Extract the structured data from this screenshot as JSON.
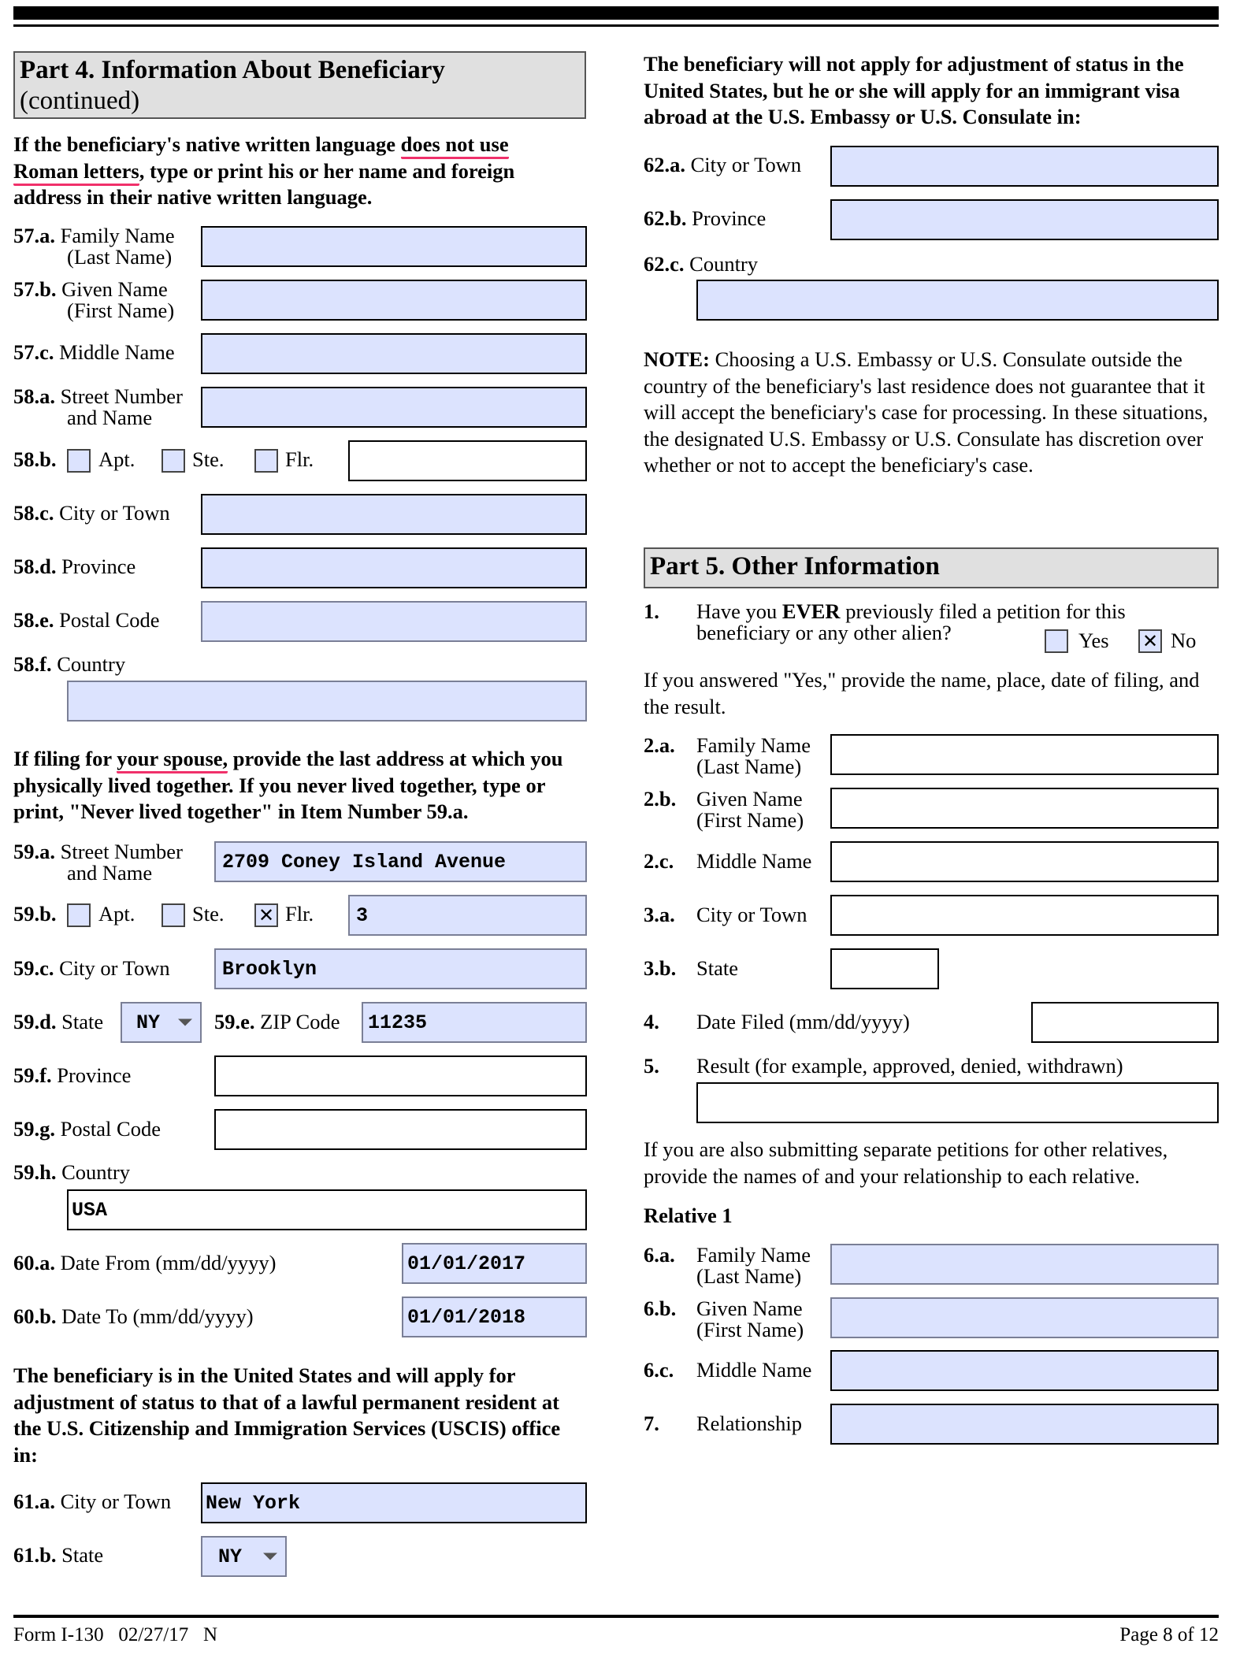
{
  "part4": {
    "title": "Part 4.  Information About Beneficiary",
    "subtitle": "(continued)",
    "native_intro": {
      "pre": "If the beneficiary's native written language ",
      "underlined1": "does not use",
      "underlined2": "Roman letters",
      "post": ", type or print his or her name and foreign address in their native written language."
    },
    "items57_58": [
      {
        "num": "57.a.",
        "label": "Family Name",
        "label2": "(Last Name)",
        "value": ""
      },
      {
        "num": "57.b.",
        "label": "Given Name",
        "label2": "(First Name)",
        "value": ""
      },
      {
        "num": "57.c.",
        "label": "Middle Name",
        "value": ""
      },
      {
        "num": "58.a.",
        "label": "Street Number",
        "label2": "and Name",
        "value": ""
      }
    ],
    "item58b": {
      "num": "58.b.",
      "apt": "Apt.",
      "ste": "Ste.",
      "flr": "Flr.",
      "apt_checked": false,
      "ste_checked": false,
      "flr_checked": false,
      "value": ""
    },
    "items58_rest": [
      {
        "num": "58.c.",
        "label": "City or Town",
        "value": ""
      },
      {
        "num": "58.d.",
        "label": "Province",
        "value": ""
      },
      {
        "num": "58.e.",
        "label": "Postal Code",
        "value": ""
      },
      {
        "num": "58.f.",
        "label": "Country",
        "value": ""
      }
    ],
    "spouse_intro": {
      "pre": "If filing for ",
      "underlined": "your spouse,",
      "post": " provide the last address at which you physically lived together.  If you never lived together, type or print, \"Never lived together\" in Item Number 59.a."
    },
    "item59a": {
      "num": "59.a.",
      "label": "Street Number",
      "label2": "and Name",
      "value": "2709 Coney Island Avenue"
    },
    "item59b": {
      "num": "59.b.",
      "apt": "Apt.",
      "ste": "Ste.",
      "flr": "Flr.",
      "apt_checked": false,
      "ste_checked": false,
      "flr_checked": true,
      "check_mark": "✕",
      "value": "3"
    },
    "item59c": {
      "num": "59.c.",
      "label": "City or Town",
      "value": "Brooklyn"
    },
    "item59d": {
      "num": "59.d.",
      "label": "State",
      "value": "NY"
    },
    "item59e": {
      "num": "59.e.",
      "label": "ZIP Code",
      "value": "11235"
    },
    "item59f": {
      "num": "59.f.",
      "label": "Province",
      "value": ""
    },
    "item59g": {
      "num": "59.g.",
      "label": "Postal Code",
      "value": ""
    },
    "item59h": {
      "num": "59.h.",
      "label": "Country",
      "value": "USA"
    },
    "item60a": {
      "num": "60.a.",
      "label": "Date From (mm/dd/yyyy)",
      "value": "01/01/2017"
    },
    "item60b": {
      "num": "60.b.",
      "label": "Date To (mm/dd/yyyy)",
      "value": "01/01/2018"
    },
    "uscis_intro": "The beneficiary is in the United States and will apply for adjustment of status to that of a lawful permanent resident at the U.S. Citizenship and Immigration Services (USCIS) office in:",
    "item61a": {
      "num": "61.a.",
      "label": "City or Town",
      "value": "New York"
    },
    "item61b": {
      "num": "61.b.",
      "label": "State",
      "value": "NY"
    }
  },
  "right": {
    "consulate_intro": "The beneficiary will not apply for adjustment of status in the United States, but he or she will apply for an immigrant visa abroad at the U.S. Embassy or U.S. Consulate in:",
    "item62a": {
      "num": "62.a.",
      "label": "City or Town",
      "value": ""
    },
    "item62b": {
      "num": "62.b.",
      "label": "Province",
      "value": ""
    },
    "item62c": {
      "num": "62.c.",
      "label": "Country",
      "value": ""
    },
    "note_label": "NOTE:",
    "note_text": "  Choosing a U.S. Embassy or U.S. Consulate outside the country of the beneficiary's last residence does not guarantee that it will accept the beneficiary's case for processing.  In these situations, the designated U.S. Embassy or U.S. Consulate has discretion over whether or not to accept the beneficiary's case."
  },
  "part5": {
    "title": "Part 5.  Other Information",
    "q1": {
      "num": "1.",
      "pre": "Have you ",
      "bold": "EVER",
      "post": " previously filed a petition for this",
      "line2": "beneficiary or any other alien?",
      "yes": "Yes",
      "no": "No",
      "yes_checked": false,
      "no_checked": true,
      "check_mark": "✕"
    },
    "yes_intro": "If you answered \"Yes,\" provide the name, place, date of filing, and the result.",
    "item2a": {
      "num": "2.a.",
      "label": "Family Name",
      "label2": "(Last Name)",
      "value": ""
    },
    "item2b": {
      "num": "2.b.",
      "label": "Given Name",
      "label2": "(First Name)",
      "value": ""
    },
    "item2c": {
      "num": "2.c.",
      "label": "Middle Name",
      "value": ""
    },
    "item3a": {
      "num": "3.a.",
      "label": "City or Town",
      "value": ""
    },
    "item3b": {
      "num": "3.b.",
      "label": "State",
      "value": ""
    },
    "item4": {
      "num": "4.",
      "label": "Date Filed (mm/dd/yyyy)",
      "value": ""
    },
    "item5": {
      "num": "5.",
      "label": "Result (for example, approved, denied, withdrawn)",
      "value": ""
    },
    "relatives_intro": "If you are also submitting separate petitions for other relatives, provide the names of and your relationship to each relative.",
    "relative1_heading": "Relative 1",
    "item6a": {
      "num": "6.a.",
      "label": "Family Name",
      "label2": "(Last Name)",
      "value": ""
    },
    "item6b": {
      "num": "6.b.",
      "label": "Given Name",
      "label2": "(First Name)",
      "value": ""
    },
    "item6c": {
      "num": "6.c.",
      "label": "Middle Name",
      "value": ""
    },
    "item7": {
      "num": "7.",
      "label": "Relationship",
      "value": ""
    }
  },
  "footer": {
    "form_id": "Form I-130   02/27/17   N",
    "page": "Page 8 of 12"
  }
}
